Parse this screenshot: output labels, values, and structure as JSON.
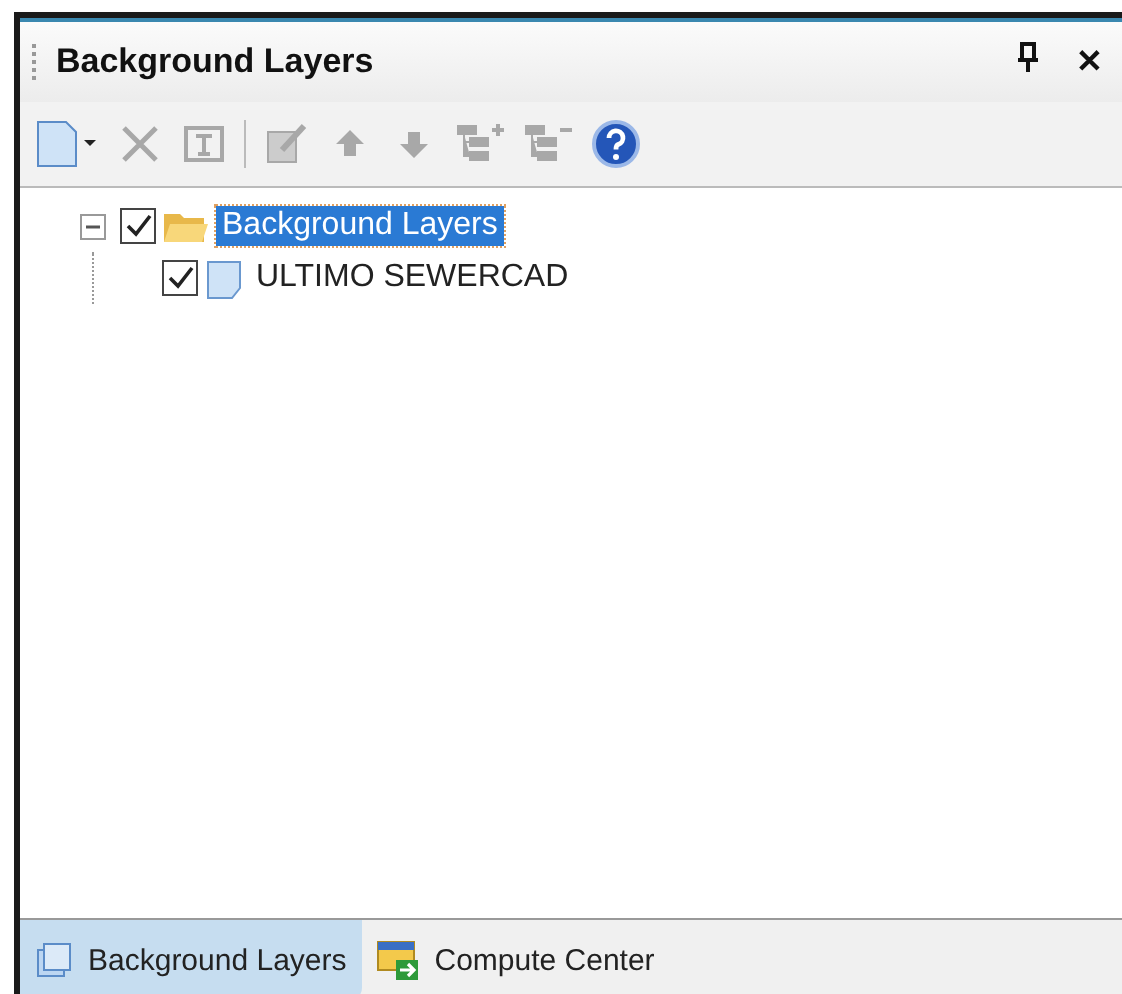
{
  "panel": {
    "title": "Background Layers",
    "close": "✕"
  },
  "toolbar": [
    {
      "kind": "new",
      "disabled": false
    },
    {
      "kind": "delete",
      "disabled": true
    },
    {
      "kind": "properties",
      "disabled": true
    },
    {
      "kind": "separator"
    },
    {
      "kind": "edit",
      "disabled": true
    },
    {
      "kind": "up",
      "disabled": true
    },
    {
      "kind": "down",
      "disabled": true
    },
    {
      "kind": "add-child",
      "disabled": true
    },
    {
      "kind": "remove-child",
      "disabled": true
    },
    {
      "kind": "help",
      "disabled": false
    }
  ],
  "tree": [
    {
      "label": "Background Layers",
      "kind": "folder",
      "checked": true,
      "selected": true,
      "expanded": true,
      "children": [
        {
          "label": "ULTIMO SEWERCAD",
          "kind": "layer",
          "checked": true,
          "selected": false
        }
      ]
    }
  ],
  "tabs": [
    {
      "label": "Background Layers",
      "kind": "layers",
      "selected": true
    },
    {
      "label": "Compute Center",
      "kind": "compute",
      "selected": false
    }
  ]
}
